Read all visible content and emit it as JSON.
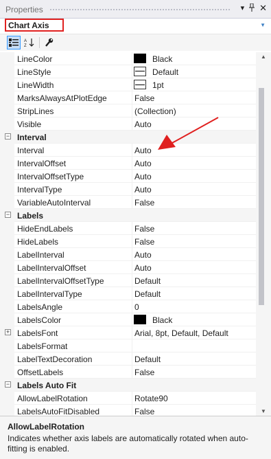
{
  "window": {
    "title": "Properties"
  },
  "selector": {
    "value": "Chart Axis"
  },
  "rows": [
    {
      "type": "prop",
      "name": "LineColor",
      "value": "Black",
      "swatch": "black"
    },
    {
      "type": "prop",
      "name": "LineStyle",
      "value": "Default",
      "swatch": "line"
    },
    {
      "type": "prop",
      "name": "LineWidth",
      "value": "1pt",
      "swatch": "width"
    },
    {
      "type": "prop",
      "name": "MarksAlwaysAtPlotEdge",
      "value": "False"
    },
    {
      "type": "prop",
      "name": "StripLines",
      "value": "(Collection)"
    },
    {
      "type": "prop",
      "name": "Visible",
      "value": "Auto"
    },
    {
      "type": "cat",
      "name": "Interval"
    },
    {
      "type": "prop",
      "name": "Interval",
      "value": "Auto"
    },
    {
      "type": "prop",
      "name": "IntervalOffset",
      "value": "Auto"
    },
    {
      "type": "prop",
      "name": "IntervalOffsetType",
      "value": "Auto"
    },
    {
      "type": "prop",
      "name": "IntervalType",
      "value": "Auto"
    },
    {
      "type": "prop",
      "name": "VariableAutoInterval",
      "value": "False"
    },
    {
      "type": "cat",
      "name": "Labels"
    },
    {
      "type": "prop",
      "name": "HideEndLabels",
      "value": "False"
    },
    {
      "type": "prop",
      "name": "HideLabels",
      "value": "False"
    },
    {
      "type": "prop",
      "name": "LabelInterval",
      "value": "Auto"
    },
    {
      "type": "prop",
      "name": "LabelIntervalOffset",
      "value": "Auto"
    },
    {
      "type": "prop",
      "name": "LabelIntervalOffsetType",
      "value": "Default"
    },
    {
      "type": "prop",
      "name": "LabelIntervalType",
      "value": "Default"
    },
    {
      "type": "prop",
      "name": "LabelsAngle",
      "value": "0"
    },
    {
      "type": "prop",
      "name": "LabelsColor",
      "value": "Black",
      "swatch": "black"
    },
    {
      "type": "prop",
      "name": "LabelsFont",
      "value": "Arial, 8pt, Default, Default",
      "expandable": true
    },
    {
      "type": "prop",
      "name": "LabelsFormat",
      "value": ""
    },
    {
      "type": "prop",
      "name": "LabelTextDecoration",
      "value": "Default"
    },
    {
      "type": "prop",
      "name": "OffsetLabels",
      "value": "False"
    },
    {
      "type": "cat",
      "name": "Labels Auto Fit"
    },
    {
      "type": "prop",
      "name": "AllowLabelRotation",
      "value": "Rotate90"
    },
    {
      "type": "prop",
      "name": "LabelsAutoFitDisabled",
      "value": "False"
    }
  ],
  "description": {
    "title": "AllowLabelRotation",
    "text": "Indicates whether axis labels are automatically rotated when auto-fitting is enabled."
  },
  "colors": {
    "accent": "#e0201f",
    "selected": "#3399ff"
  },
  "icons": {
    "categorized": "categorized-icon",
    "alphabetical": "alphabetical-sort-icon",
    "pages": "wrench-icon"
  }
}
